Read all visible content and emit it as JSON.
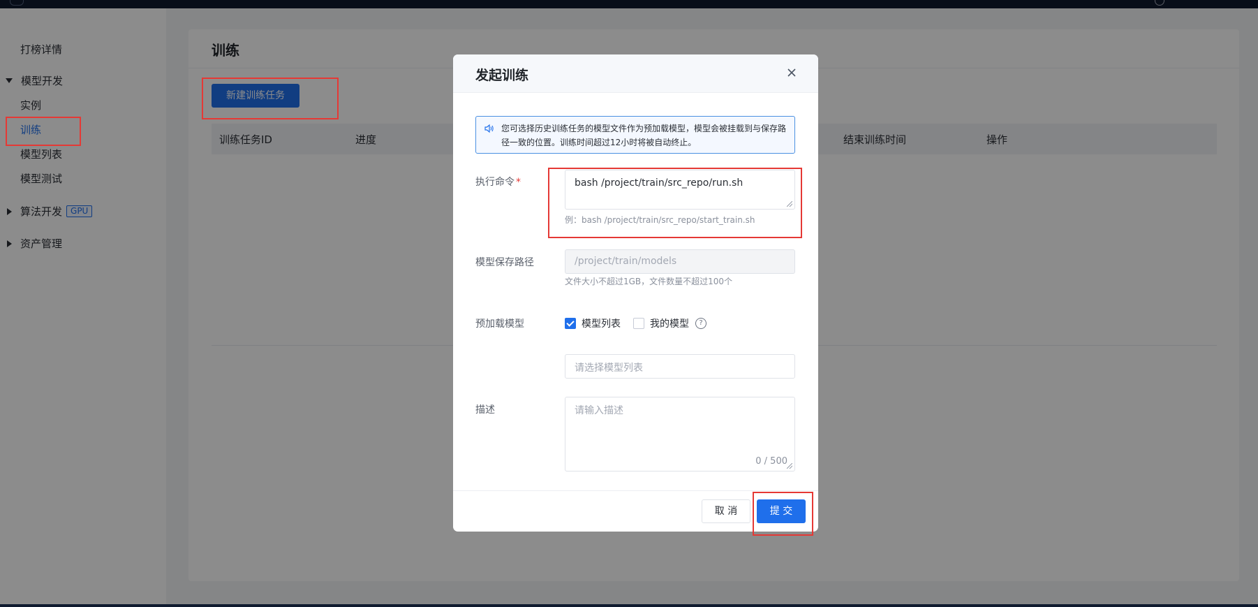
{
  "sidebar": {
    "items": [
      {
        "label": "打榜详情"
      },
      {
        "label": "模型开发"
      },
      {
        "label": "实例"
      },
      {
        "label": "训练"
      },
      {
        "label": "模型列表"
      },
      {
        "label": "模型测试"
      },
      {
        "label": "算法开发"
      },
      {
        "label": "资产管理"
      }
    ],
    "gpu_badge": "GPU"
  },
  "main": {
    "title": "训练",
    "new_button": "新建训练任务",
    "table_headers": [
      "训练任务ID",
      "进度",
      "结束训练时间",
      "操作"
    ]
  },
  "modal": {
    "title": "发起训练",
    "notice": "您可选择历史训练任务的模型文件作为预加载模型，模型会被挂载到与保存路径一致的位置。训练时间超过12小时将被自动终止。",
    "cmd_label": "执行命令",
    "required_mark": "*",
    "cmd_value": "bash /project/train/src_repo/run.sh",
    "cmd_example": "例：bash /project/train/src_repo/start_train.sh",
    "path_label": "模型保存路径",
    "path_placeholder": "/project/train/models",
    "path_hint": "文件大小不超过1GB，文件数量不超过100个",
    "preload_label": "预加载模型",
    "option_list": "模型列表",
    "option_mine": "我的模型",
    "help_glyph": "?",
    "select_placeholder": "请选择模型列表",
    "desc_label": "描述",
    "desc_placeholder": "请输入描述",
    "desc_count": "0 / 500",
    "cancel_label": "取 消",
    "submit_label": "提 交"
  },
  "colors": {
    "accent": "#1f6feb",
    "highlight": "#e53935",
    "overlay": "rgba(0,0,0,0.45)"
  }
}
